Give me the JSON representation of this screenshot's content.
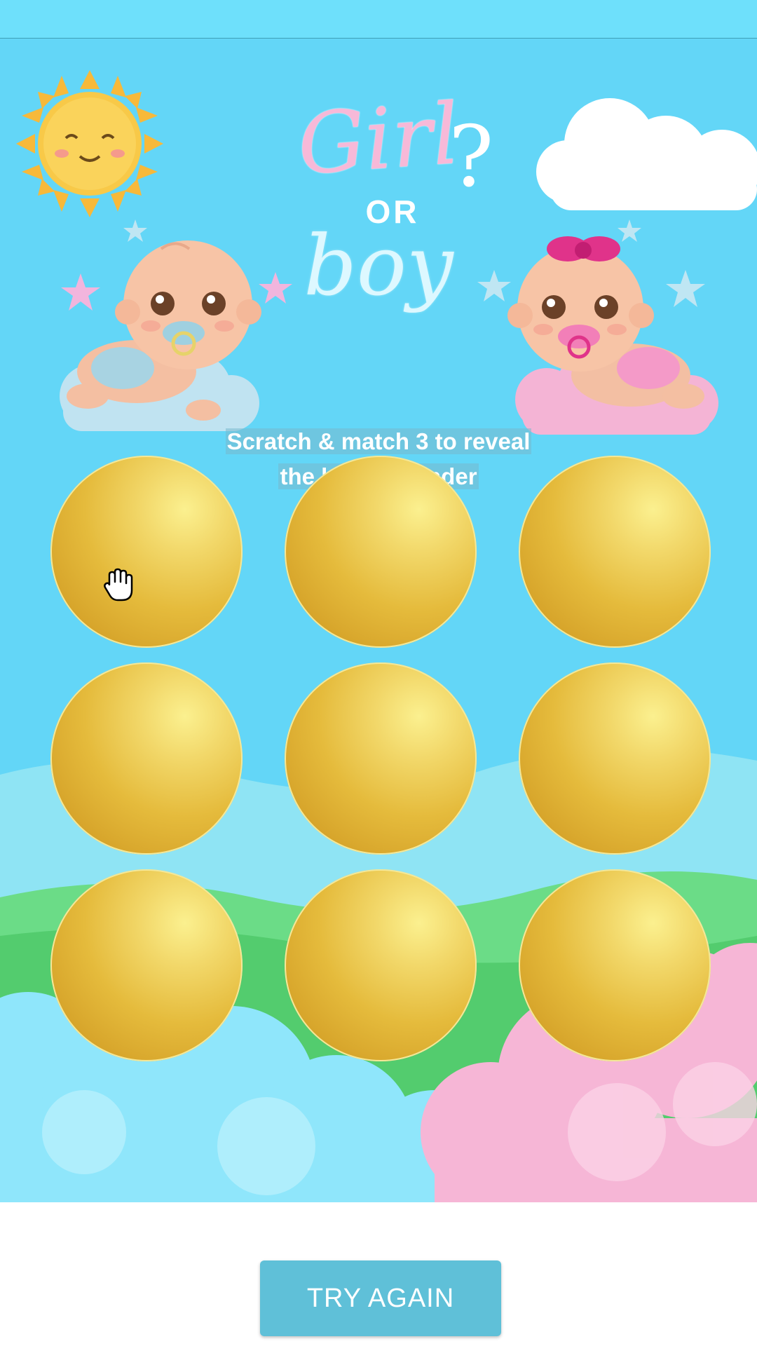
{
  "game": {
    "title_girl": "Girl",
    "title_or": "OR",
    "title_boy": "boy",
    "title_question": "?",
    "instruction_line1": "Scratch & match 3 to reveal",
    "instruction_line2": "the baby's gender",
    "scratch_circles": [
      {
        "row": 1,
        "col": 1,
        "state": "unscratched"
      },
      {
        "row": 1,
        "col": 2,
        "state": "unscratched"
      },
      {
        "row": 1,
        "col": 3,
        "state": "unscratched"
      },
      {
        "row": 2,
        "col": 1,
        "state": "unscratched"
      },
      {
        "row": 2,
        "col": 2,
        "state": "unscratched"
      },
      {
        "row": 2,
        "col": 3,
        "state": "unscratched"
      },
      {
        "row": 3,
        "col": 1,
        "state": "unscratched"
      },
      {
        "row": 3,
        "col": 2,
        "state": "unscratched"
      },
      {
        "row": 3,
        "col": 3,
        "state": "unscratched"
      }
    ],
    "try_again_label": "TRY AGAIN"
  },
  "colors": {
    "sky": "#63d6f7",
    "gold": "#e5bb3c",
    "button": "#5fc0d8",
    "boy_cloud": "#a8e9fb",
    "girl_cloud": "#f6b6d6",
    "hills": "#5fd17a"
  },
  "icons": [
    "sun-icon",
    "cloud-icon",
    "star-icon",
    "baby-boy-icon",
    "baby-girl-icon",
    "hand-cursor-icon"
  ]
}
